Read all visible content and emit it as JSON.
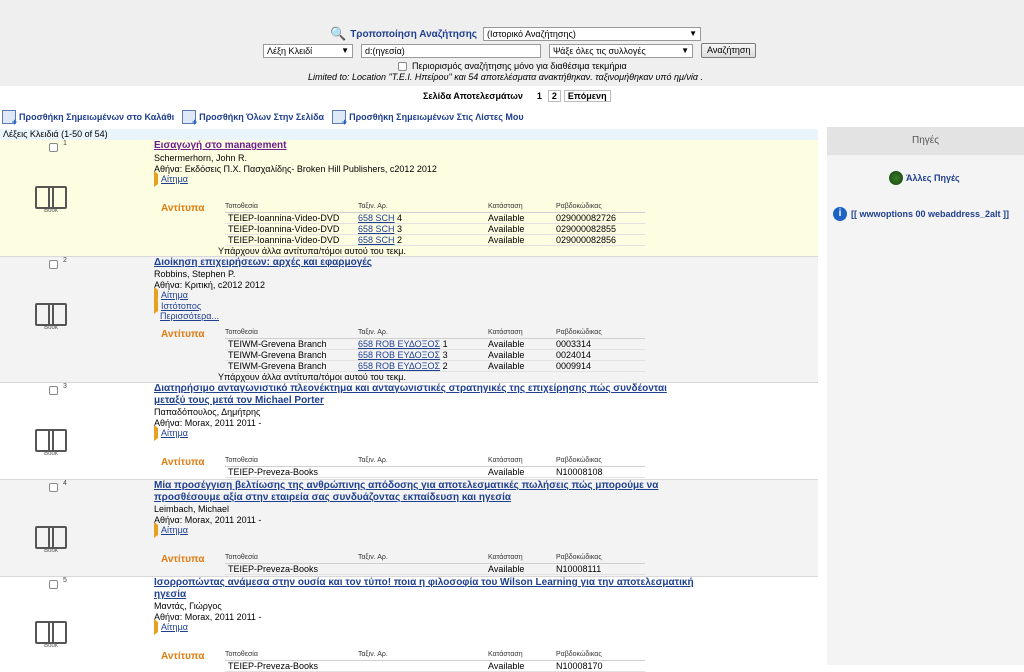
{
  "search": {
    "modify_label": "Τροποποίηση Αναζήτησης",
    "history_select": "(Ιστορικό Αναζήτησης)",
    "keyword_select": "Λέξη Κλειδί",
    "query_value": "d:(ηγεσία)",
    "collection_select": "Ψάξε όλες τις συλλογές",
    "search_button": "Αναζήτηση",
    "limit_checkbox_label": "Περιορισμός αναζήτησης μόνο για διαθέσιμα τεκμήρια",
    "limited_to": "Limited to: Location \"T.E.I. Ηπείρου\" και 54 αποτελέσματα ανακτήθηκαν. ταξινομήθηκαν υπό ημ/νία ."
  },
  "pager": {
    "label": "Σελίδα Αποτελεσμάτων",
    "pages": [
      "1",
      "2"
    ],
    "next": "Επόμενη"
  },
  "actions": {
    "add_marked_cart": "Προσθήκη Σημειωμένων στο Καλάθι",
    "add_all_page": "Προσθήκη Όλων Στην Σελίδα",
    "add_marked_lists": "Προσθήκη Σημειωμένων Στις Λίστες Μου"
  },
  "keywords_line": "Λέξεις Κλειδιά (1-50 of 54)",
  "sidebar": {
    "header": "Πηγές",
    "other_sources": "Άλλες Πηγές",
    "webaddress": "[[ wwwoptions 00 webaddress_2alt ]]"
  },
  "labels": {
    "book": "Book",
    "available_copies": "Αντίτυπα",
    "col_location": "Τοποθεσία",
    "col_callno": "Ταξιν. Αρ.",
    "col_status": "Κατάσταση",
    "col_barcode": "Ραβδοκώδικας",
    "more_copies": "Υπάρχουν άλλα αντίτυπα/τόμοι αυτού του τεκμ.",
    "request": "Αίτημα",
    "website": "Ιστότοπος",
    "more": "Περισσότερα..."
  },
  "records": [
    {
      "num": "1",
      "title": "Εισαγωγή στο management",
      "author": "Schermerhorn, John R.",
      "pub": "Αθήνα: Εκδόσεις Π.Χ. Πασχαλίδης- Broken Hill Publishers, c2012 2012",
      "holdings": [
        {
          "loc": "TEIEP-Ioannina-Video-DVD",
          "call": "658 SCH",
          "copy": "4",
          "status": "Available",
          "barcode": "029000082726"
        },
        {
          "loc": "TEIEP-Ioannina-Video-DVD",
          "call": "658 SCH",
          "copy": "3",
          "status": "Available",
          "barcode": "029000082855"
        },
        {
          "loc": "TEIEP-Ioannina-Video-DVD",
          "call": "658 SCH",
          "copy": "2",
          "status": "Available",
          "barcode": "029000082856"
        }
      ]
    },
    {
      "num": "2",
      "title": "Διοίκηση επιχειρήσεων: αρχές και εφαρμογές",
      "author": "Robbins, Stephen P.",
      "pub": "Αθήνα: Κριτική, c2012 2012",
      "holdings": [
        {
          "loc": "TEIWM-Grevena Branch",
          "call": "658 ROB ΕΥΔΟΞΟΣ",
          "copy": "1",
          "status": "Available",
          "barcode": "0003314"
        },
        {
          "loc": "TEIWM-Grevena Branch",
          "call": "658 ROB ΕΥΔΟΞΟΣ",
          "copy": "3",
          "status": "Available",
          "barcode": "0024014"
        },
        {
          "loc": "TEIWM-Grevena Branch",
          "call": "658 ROB ΕΥΔΟΞΟΣ",
          "copy": "2",
          "status": "Available",
          "barcode": "0009914"
        }
      ]
    },
    {
      "num": "3",
      "title": "Διατηρήσιμο ανταγωνιστικό πλεονέκτημα και ανταγωνιστικές στρατηγικές της επιχείρησης πώς συνδέονται μεταξύ τους μετά τον Michael Porter",
      "author": "Παπαδόπουλος, Δημήτρης",
      "pub": "Αθήνα: Morax, 2011 2011 -",
      "holdings": [
        {
          "loc": "TEIEP-Preveza-Books",
          "call": "",
          "copy": "",
          "status": "Available",
          "barcode": "N10008108"
        }
      ]
    },
    {
      "num": "4",
      "title": "Μία προσέγγιση βελτίωσης της ανθρώπινης απόδοσης για αποτελεσματικές πωλήσεις πώς μπορούμε να προσθέσουμε αξία στην εταιρεία σας συνδυάζοντας εκπαίδευση και ηγεσία",
      "author": "Leimbach, Michael",
      "pub": "Αθήνα: Morax, 2011 2011 -",
      "holdings": [
        {
          "loc": "TEIEP-Preveza-Books",
          "call": "",
          "copy": "",
          "status": "Available",
          "barcode": "N10008111"
        }
      ]
    },
    {
      "num": "5",
      "title": "Ισορροπώντας ανάμεσα στην ουσία και τον τύπο! ποια η φιλοσοφία του Wilson Learning για την αποτελεσματική ηγεσία",
      "author": "Μαντάς, Γιώργος",
      "pub": "Αθήνα: Morax, 2011 2011 -",
      "holdings": [
        {
          "loc": "TEIEP-Preveza-Books",
          "call": "",
          "copy": "",
          "status": "Available",
          "barcode": "N10008170"
        }
      ]
    }
  ],
  "colors": {
    "row_highlight": "#fdfde2",
    "row_alt": "#f3f3f3",
    "link": "#1f3f8f",
    "available_label": "#e07b10"
  }
}
